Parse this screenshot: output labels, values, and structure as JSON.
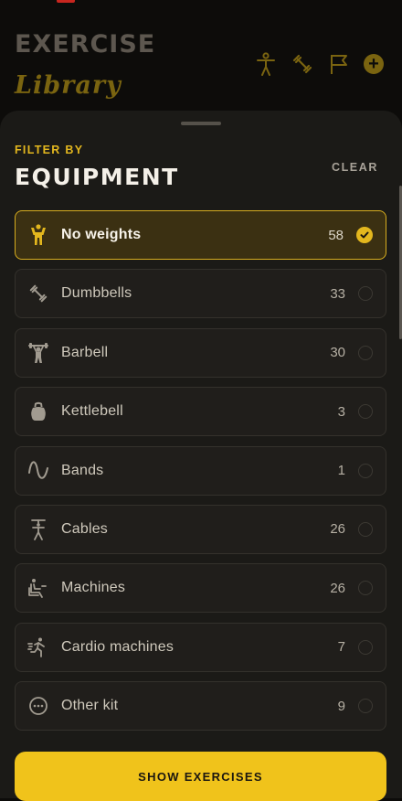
{
  "header": {
    "title_line1": "EXERCISE",
    "title_line2": "Library",
    "icons": [
      "person-icon",
      "dumbbell-icon",
      "flag-icon",
      "add-icon"
    ]
  },
  "sheet": {
    "overline": "FILTER BY",
    "title": "EQUIPMENT",
    "clear_label": "CLEAR",
    "items": [
      {
        "label": "No weights",
        "count": "58",
        "icon": "bodyweight-icon",
        "selected": true
      },
      {
        "label": "Dumbbells",
        "count": "33",
        "icon": "dumbbell-icon",
        "selected": false
      },
      {
        "label": "Barbell",
        "count": "30",
        "icon": "barbell-icon",
        "selected": false
      },
      {
        "label": "Kettlebell",
        "count": "3",
        "icon": "kettlebell-icon",
        "selected": false
      },
      {
        "label": "Bands",
        "count": "1",
        "icon": "band-icon",
        "selected": false
      },
      {
        "label": "Cables",
        "count": "26",
        "icon": "cable-icon",
        "selected": false
      },
      {
        "label": "Machines",
        "count": "26",
        "icon": "machine-icon",
        "selected": false
      },
      {
        "label": "Cardio machines",
        "count": "7",
        "icon": "cardio-icon",
        "selected": false
      },
      {
        "label": "Other kit",
        "count": "9",
        "icon": "more-icon",
        "selected": false
      }
    ],
    "cta_label": "SHOW EXERCISES"
  },
  "colors": {
    "accent": "#f0c31b",
    "background": "#0d0c0a",
    "sheet": "#1b1a17"
  }
}
